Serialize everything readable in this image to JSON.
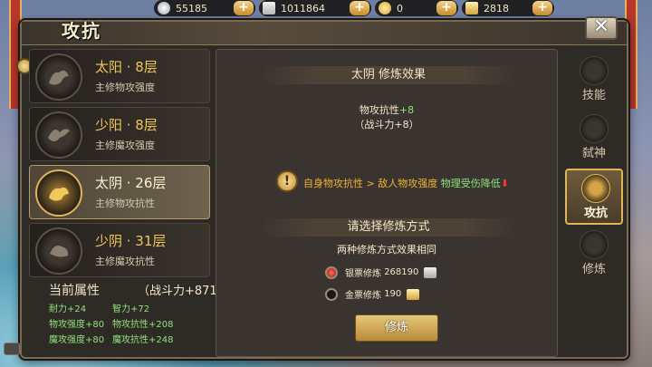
{
  "resources": [
    {
      "icon": "silver-coin-icon",
      "value": "55185"
    },
    {
      "icon": "silver-ticket-icon",
      "value": "1011864"
    },
    {
      "icon": "gold-coin-icon",
      "value": "0"
    },
    {
      "icon": "gold-ticket-icon",
      "value": "2818"
    }
  ],
  "plus_label": "+",
  "window": {
    "title": "攻抗",
    "close": "✕"
  },
  "list": [
    {
      "name": "太阳 · 8层",
      "desc": "主修物攻强度"
    },
    {
      "name": "少阳 · 8层",
      "desc": "主修魔攻强度"
    },
    {
      "name": "太阴 · 26层",
      "desc": "主修物攻抗性"
    },
    {
      "name": "少阴 · 31层",
      "desc": "主修魔攻抗性"
    }
  ],
  "props": {
    "title": "当前属性",
    "power": "（战斗力+871）",
    "rows": [
      [
        "耐力+24",
        "智力+72"
      ],
      [
        "物攻强度+80",
        "物攻抗性+208"
      ],
      [
        "魔攻强度+80",
        "魔攻抗性+248"
      ]
    ]
  },
  "effect": {
    "heading": "太阴 修炼效果",
    "stat_label": "物攻抗性",
    "stat_value": "+8",
    "power": "（战斗力+8）",
    "warning_a": "自身物攻抗性 > 敌人物攻强度",
    "warning_b": "物理受伤降低",
    "warning_arrow": "⬇"
  },
  "method": {
    "heading": "请选择修炼方式",
    "note": "两种修炼方式效果相同",
    "options": [
      {
        "label": "银票修炼",
        "cost": "268190"
      },
      {
        "label": "金票修炼",
        "cost": "190"
      }
    ],
    "button": "修炼"
  },
  "tabs": [
    "技能",
    "弑神",
    "攻抗",
    "修炼"
  ]
}
